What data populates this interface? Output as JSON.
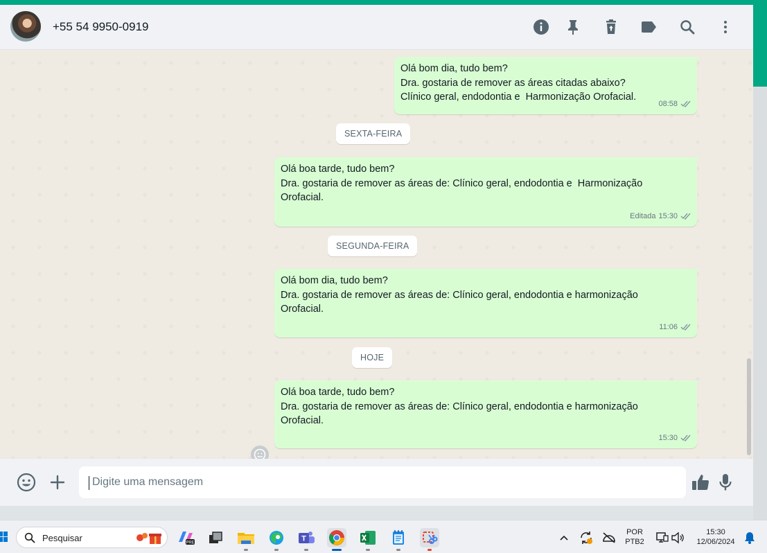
{
  "header": {
    "contact_name": "+55 54 9950-0919",
    "icons": [
      "info-icon",
      "pin-icon",
      "delete-icon",
      "label-icon",
      "search-icon",
      "menu-icon"
    ]
  },
  "messages": [
    {
      "lines": [
        "Olá bom dia, tudo bem?",
        "Dra. gostaria de remover as áreas citadas abaixo?",
        "Clínico geral, endodontia e  Harmonização Orofacial."
      ],
      "time": "08:58",
      "edited": ""
    },
    {
      "lines": [
        "Olá boa tarde, tudo bem?",
        "",
        "Dra. gostaria de remover as áreas de: Clínico geral, endodontia e  Harmonização",
        "Orofacial."
      ],
      "time": "15:30",
      "edited": "Editada"
    },
    {
      "lines": [
        "Olá bom dia, tudo bem?",
        "",
        "Dra. gostaria de remover as áreas de: Clínico geral, endodontia e harmonização",
        "Orofacial."
      ],
      "time": "11:06",
      "edited": ""
    },
    {
      "lines": [
        "Olá boa tarde, tudo bem?",
        "",
        "Dra. gostaria de remover as áreas de: Clínico geral, endodontia e harmonização",
        "Orofacial."
      ],
      "time": "15:30",
      "edited": ""
    }
  ],
  "date_chips": [
    "SEXTA-FEIRA",
    "SEGUNDA-FEIRA",
    "HOJE"
  ],
  "composer": {
    "placeholder": "Digite uma mensagem"
  },
  "taskbar": {
    "search_label": "Pesquisar",
    "language": "POR",
    "layout": "PTB2",
    "time": "15:30",
    "date": "12/06/2024"
  },
  "colors": {
    "accent": "#00a884",
    "outgoing_bubble": "#d9fdd3",
    "chat_background": "#efeae2",
    "header_background": "#f0f2f5"
  }
}
